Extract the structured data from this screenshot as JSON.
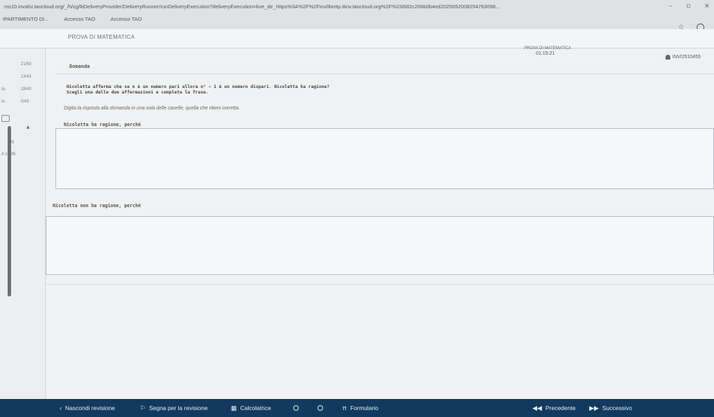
{
  "browser": {
    "url": "ms10.invalsi.taocloud.org/_/h/cg/ltiDeliveryProvider/DeliveryRunner/runDeliveryExecution?deliveryExecution=kve_de_https%3A%2F%2Finv0bmtp.itinv.taocloud.org%2F%23i682c206b0b4ed2025052008254763098...",
    "bookmarks": [
      "IPARTIMENTO DI...",
      "Accesso TAO",
      "Accesso TAO"
    ],
    "window_controls": [
      "–",
      "▫",
      "×"
    ]
  },
  "header": {
    "test_title": "PROVA DI MATEMATICA",
    "timer_label": "PROVA DI MATEMATICA",
    "timer": "01:15:21",
    "user_id": "INVI2510455"
  },
  "sidebar": {
    "rows": [
      {
        "label": "",
        "value": "21/50"
      },
      {
        "label": "",
        "value": "13/43"
      },
      {
        "label": "ta",
        "value": "28/43"
      },
      {
        "label": "to",
        "value": "0/43"
      }
    ],
    "count": "5/5",
    "section": "A 16/36"
  },
  "question": {
    "heading": "Domanda",
    "stem_line1": "Nicoletta afferma che se n è un numero pari allora n² − 1 è un numero dispari. Nicoletta ha ragione?",
    "stem_line2": "Scegli una delle due affermazioni e completa la frase.",
    "instruction": "Digita la risposta alla domanda in una sola delle caselle, quella che ritieni corretta.",
    "option1_label": "Nicoletta ha ragione, perché",
    "option2_label": "Nicoletta non ha ragione, perché"
  },
  "toolbar": {
    "hide_review": "Nascondi revisione",
    "mark_review": "Segna per la revisione",
    "calculator": "Calcolatrice",
    "formulary": "Formulario",
    "previous": "Precedente",
    "next": "Successivo"
  }
}
